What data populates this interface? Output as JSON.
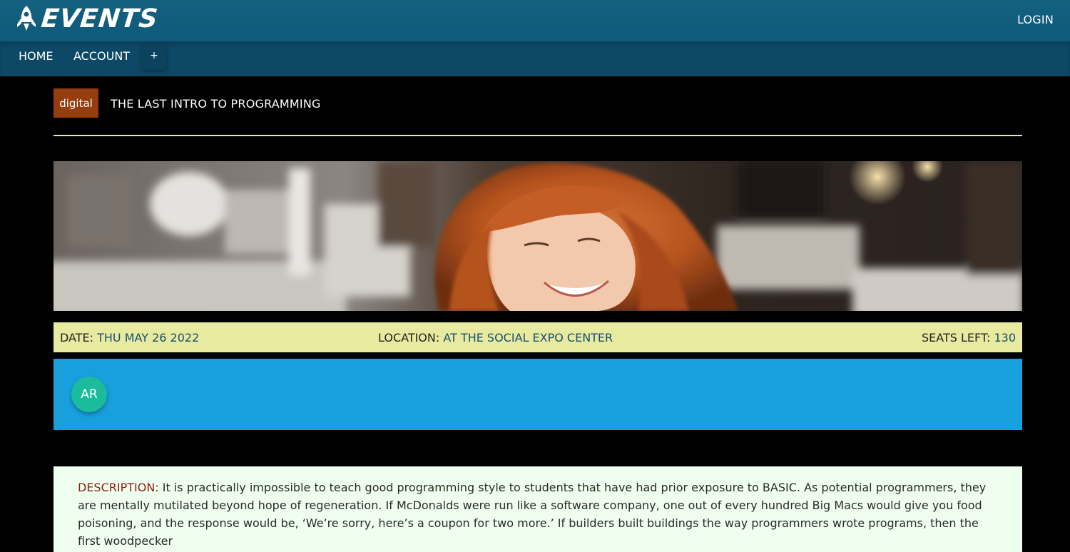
{
  "header": {
    "brand": "EVENTS",
    "login_label": "LOGIN"
  },
  "nav": {
    "home_label": "HOME",
    "account_label": "ACCOUNT",
    "add_label": "+"
  },
  "event": {
    "category": "digital",
    "title": "THE LAST INTRO TO PROGRAMMING",
    "date_label": "DATE:",
    "date_value": "THU MAY 26 2022",
    "location_label": "LOCATION:",
    "location_value": "AT THE SOCIAL EXPO CENTER",
    "seats_label": "SEATS LEFT:",
    "seats_value": "130",
    "description_label": "DESCRIPTION:",
    "description_text": "It is practically impossible to teach good programming style to students that have had prior exposure to BASIC. As potential programmers, they are mentally mutilated beyond hope of regeneration. If McDonalds were run like a software company, one out of every hundred Big Macs would give you food poisoning, and the response would be, ‘We’re sorry, here’s a coupon for two more.’ If builders built buildings the way programmers wrote programs, then the first woodpecker"
  },
  "attendees": [
    {
      "initials": "AR"
    }
  ],
  "colors": {
    "topbar": "#0f5a7a",
    "navbar": "#0d4966",
    "category_badge": "#963d0f",
    "info_bar": "#e8ea9f",
    "attendees_panel": "#18a0dc",
    "avatar": "#1abc9c",
    "description_bg": "#efffef",
    "description_label": "#8b1d0e"
  },
  "icons": {
    "brand_logo": "rocket-icon"
  }
}
